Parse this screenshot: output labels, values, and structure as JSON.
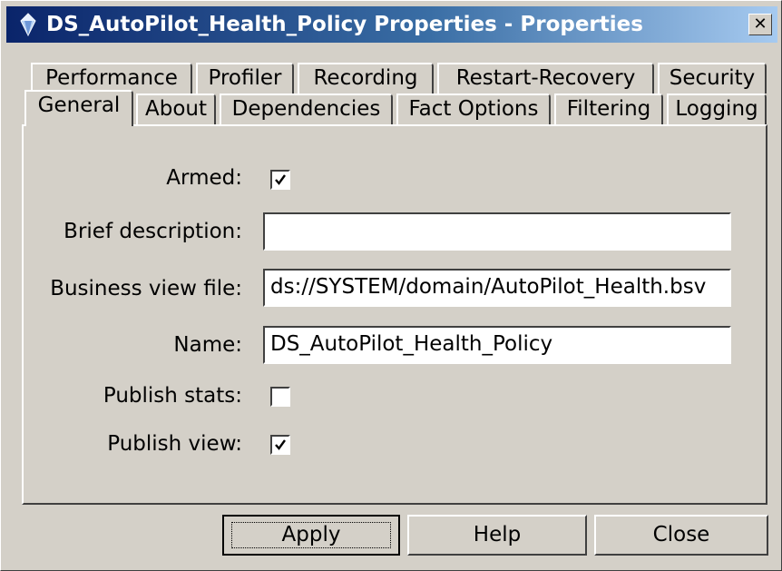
{
  "window": {
    "title": "DS_AutoPilot_Health_Policy Properties - Properties",
    "close_label": "✕"
  },
  "tabs": {
    "row_back": [
      {
        "label": "Performance"
      },
      {
        "label": "Profiler"
      },
      {
        "label": "Recording"
      },
      {
        "label": "Restart-Recovery"
      },
      {
        "label": "Security"
      }
    ],
    "row_front": [
      {
        "label": "General",
        "selected": true
      },
      {
        "label": "About"
      },
      {
        "label": "Dependencies"
      },
      {
        "label": "Fact Options"
      },
      {
        "label": "Filtering"
      },
      {
        "label": "Logging"
      }
    ]
  },
  "form": {
    "armed": {
      "label": "Armed:",
      "checked": true
    },
    "brief_description": {
      "label": "Brief description:",
      "value": ""
    },
    "business_view_file": {
      "label": "Business view file:",
      "value": "ds://SYSTEM/domain/AutoPilot_Health.bsv"
    },
    "name": {
      "label": "Name:",
      "value": "DS_AutoPilot_Health_Policy"
    },
    "publish_stats": {
      "label": "Publish stats:",
      "checked": false
    },
    "publish_view": {
      "label": "Publish view:",
      "checked": true
    }
  },
  "buttons": {
    "apply": "Apply",
    "help": "Help",
    "close": "Close"
  },
  "colors": {
    "titlebar_start": "#0a246a",
    "titlebar_end": "#a6caf0",
    "face": "#d4d0c8"
  }
}
